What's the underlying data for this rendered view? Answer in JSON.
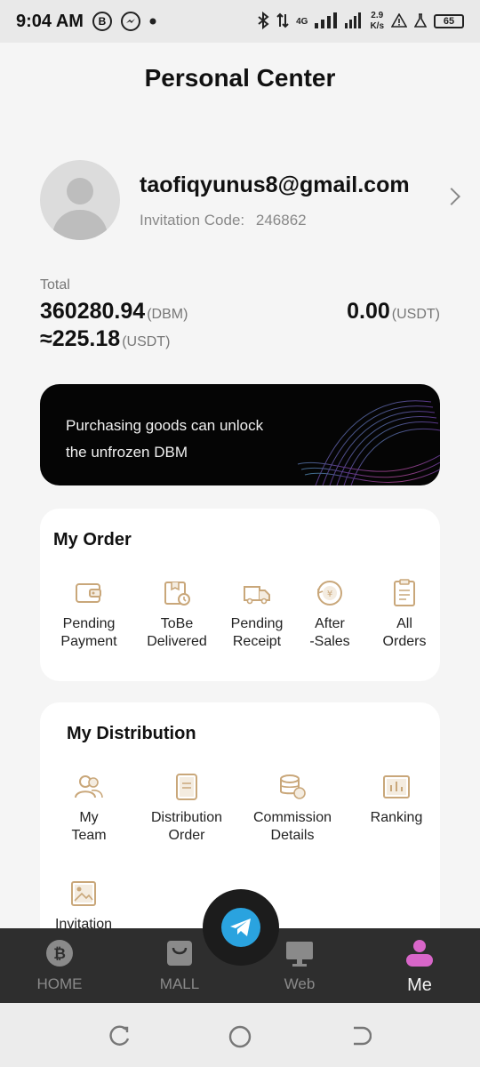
{
  "status_bar": {
    "time": "9:04 AM",
    "b_badge": "B",
    "network": "4G",
    "speed_value": "2.9",
    "speed_unit": "K/s",
    "battery": "65"
  },
  "header": {
    "title": "Personal Center"
  },
  "profile": {
    "email": "taofiqyunus8@gmail.com",
    "invitation_label": "Invitation Code:",
    "invitation_code": "246862"
  },
  "totals": {
    "label": "Total",
    "dbm_value": "360280.94",
    "dbm_unit": "(DBM)",
    "approx_value": "≈225.18",
    "approx_unit": "(USDT)",
    "usdt_value": "0.00",
    "usdt_unit": "(USDT)"
  },
  "banner": {
    "line1": "Purchasing goods can unlock",
    "line2": "the unfrozen DBM"
  },
  "my_order": {
    "title": "My Order",
    "items": [
      {
        "line1": "Pending",
        "line2": "Payment",
        "icon": "wallet-icon"
      },
      {
        "line1": "ToBe",
        "line2": "Delivered",
        "icon": "box-clock-icon"
      },
      {
        "line1": "Pending",
        "line2": "Receipt",
        "icon": "truck-icon"
      },
      {
        "line1": "After",
        "line2": "-Sales",
        "icon": "refund-icon"
      },
      {
        "line1": "All",
        "line2": "Orders",
        "icon": "clipboard-icon"
      }
    ]
  },
  "my_distribution": {
    "title": "My Distribution",
    "items": [
      {
        "line1": "My",
        "line2": "Team",
        "icon": "team-icon"
      },
      {
        "line1": "Distribution",
        "line2": "Order",
        "icon": "document-icon"
      },
      {
        "line1": "Commission",
        "line2": "Details",
        "icon": "coins-icon"
      },
      {
        "line1": "Ranking",
        "line2": "",
        "icon": "bar-chart-icon"
      },
      {
        "line1": "Invitation",
        "line2": "",
        "icon": "image-icon"
      }
    ]
  },
  "bottom_nav": {
    "items": [
      {
        "label": "HOME",
        "icon": "bitcoin-icon"
      },
      {
        "label": "MALL",
        "icon": "shopping-bag-icon"
      },
      {
        "label": "Web",
        "icon": "monitor-icon"
      },
      {
        "label": "Me",
        "icon": "person-icon",
        "active": true
      }
    ],
    "fab_icon": "telegram-icon"
  },
  "colors": {
    "accent_gold": "#c9a77a",
    "active_pink": "#d866c9",
    "telegram_blue": "#2aa3df"
  }
}
